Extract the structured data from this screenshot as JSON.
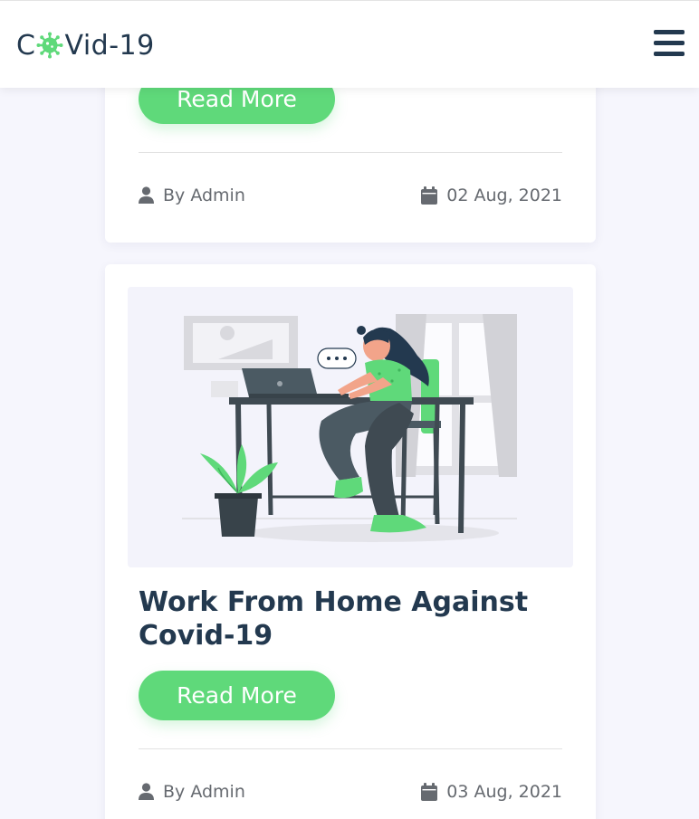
{
  "header": {
    "logo_prefix": "C",
    "logo_suffix": "Vid-19",
    "logo_icon": "virus-icon",
    "menu_icon": "hamburger-menu-icon"
  },
  "posts": [
    {
      "read_more_label": "Read More",
      "author": "By Admin",
      "date": "02 Aug, 2021"
    },
    {
      "title": "Work From Home Against Covid-19",
      "image": "work-from-home-illustration",
      "read_more_label": "Read More",
      "author": "By Admin",
      "date": "03 Aug, 2021"
    }
  ],
  "colors": {
    "accent": "#5fd97a",
    "dark": "#23394f",
    "meta_text": "#666a70",
    "page_bg": "#f6f6fd"
  }
}
